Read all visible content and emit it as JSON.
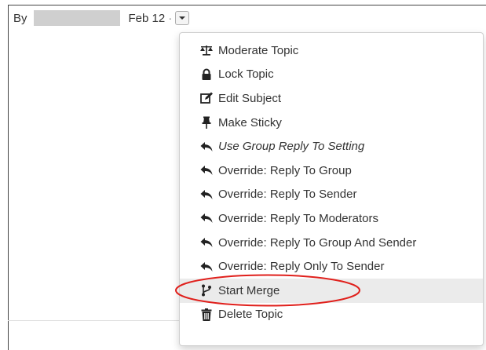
{
  "post": {
    "by_label": "By",
    "date": "Feb 12",
    "separator": "·"
  },
  "menu": {
    "items": [
      {
        "label": "Moderate Topic",
        "icon": "balance-scale-icon"
      },
      {
        "label": "Lock Topic",
        "icon": "lock-icon"
      },
      {
        "label": "Edit Subject",
        "icon": "edit-icon"
      },
      {
        "label": "Make Sticky",
        "icon": "thumbtack-icon"
      },
      {
        "label": "Use Group Reply To Setting",
        "icon": "reply-icon"
      },
      {
        "label": "Override: Reply To Group",
        "icon": "reply-icon"
      },
      {
        "label": "Override: Reply To Sender",
        "icon": "reply-icon"
      },
      {
        "label": "Override: Reply To Moderators",
        "icon": "reply-icon"
      },
      {
        "label": "Override: Reply To Group And Sender",
        "icon": "reply-icon"
      },
      {
        "label": "Override: Reply Only To Sender",
        "icon": "reply-icon"
      },
      {
        "label": "Start Merge",
        "icon": "code-branch-icon"
      },
      {
        "label": "Delete Topic",
        "icon": "trash-icon"
      }
    ]
  },
  "colors": {
    "annotation": "#e0201c",
    "hover_background": "#ebebeb",
    "text": "#333333"
  }
}
